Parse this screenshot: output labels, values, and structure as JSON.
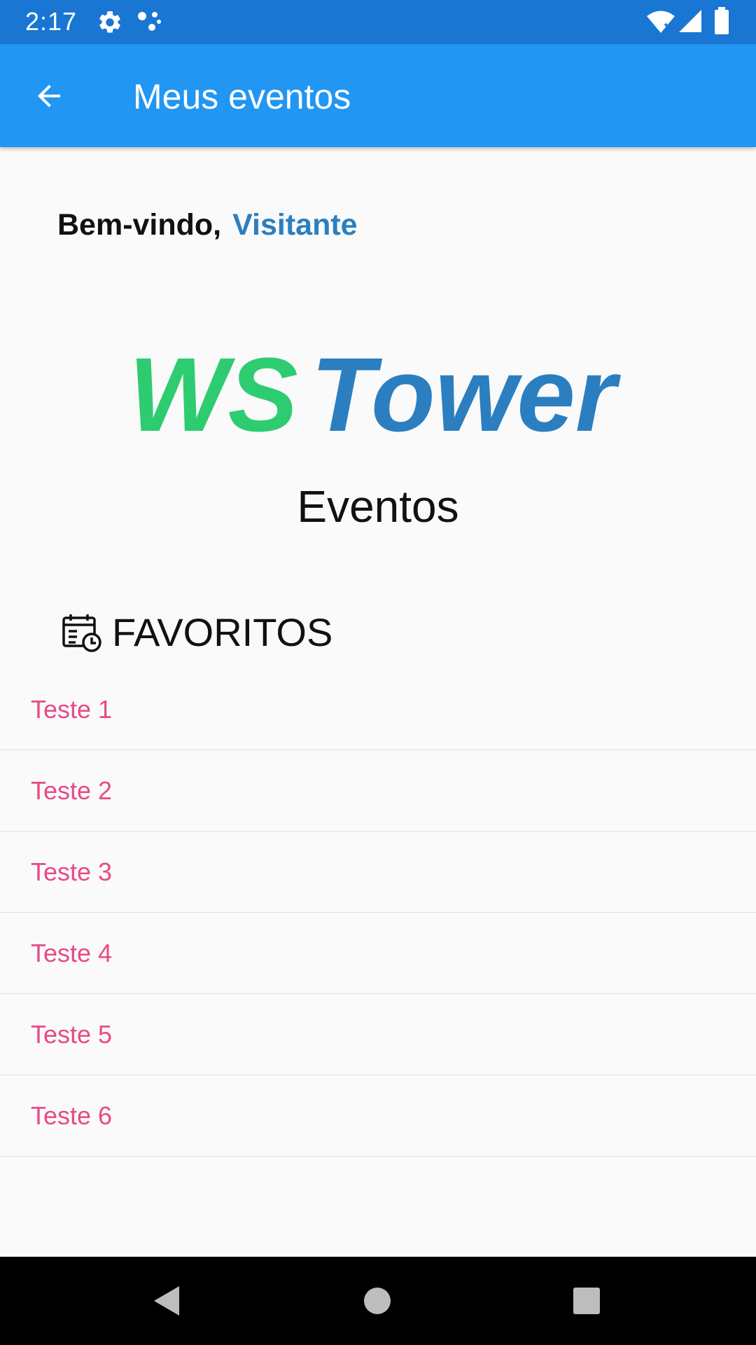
{
  "status_bar": {
    "time": "2:17",
    "icons": [
      "settings-icon",
      "dots-icon",
      "wifi-icon",
      "signal-icon",
      "battery-icon"
    ]
  },
  "app_bar": {
    "title": "Meus eventos",
    "back_icon": "arrow-back-icon",
    "color": "#2196f3"
  },
  "welcome": {
    "greeting": "Bem-vindo,",
    "user_name": "Visitante",
    "user_color": "#2b7fc0"
  },
  "logo": {
    "part1": "WS",
    "part2": "Tower",
    "color1": "#2ecc71",
    "color2": "#2b7fc0"
  },
  "events_heading": "Eventos",
  "favorites": {
    "label": "FAVORITOS",
    "icon": "calendar-clock-icon",
    "item_color": "#e84a86",
    "items": [
      "Teste 1",
      "Teste 2",
      "Teste 3",
      "Teste 4",
      "Teste 5",
      "Teste 6"
    ]
  },
  "nav_bar": {
    "buttons": [
      "back-triangle-icon",
      "home-circle-icon",
      "recents-square-icon"
    ]
  }
}
